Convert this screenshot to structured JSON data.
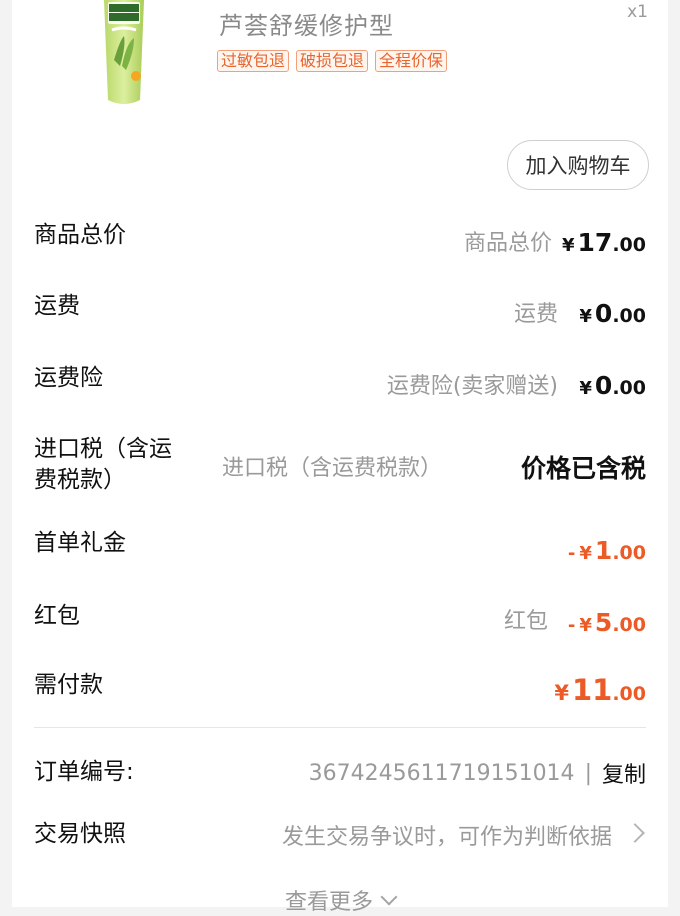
{
  "product": {
    "title": "芦荟舒缓修护型",
    "quantity": "x1",
    "tags": [
      "过敏包退",
      "破损包退",
      "全程价保"
    ],
    "image_icon": "aloe-vera-hand-cream-tube",
    "image_lettering": [
      "INSTITUTO ESPAÑOL",
      "AloeVera"
    ]
  },
  "cart_button": {
    "label": "加入购物车"
  },
  "rows": {
    "goods_total": {
      "label": "商品总价",
      "sub": "商品总价",
      "yen": "¥",
      "int": "17",
      "dec": ".00"
    },
    "shipping": {
      "label": "运费",
      "sub": "运费",
      "yen": "¥",
      "int": "0",
      "dec": ".00"
    },
    "shipping_insurance": {
      "label": "运费险",
      "sub": "运费险(卖家赠送)",
      "yen": "¥",
      "int": "0",
      "dec": ".00"
    },
    "import_tax": {
      "label_line1": "进口税（含运",
      "label_line2": "费税款）",
      "sub": "进口税（含运费税款）",
      "value": "价格已含税"
    },
    "first_order_gift": {
      "label": "首单礼金",
      "prefix": "-",
      "yen": "¥",
      "int": "1",
      "dec": ".00"
    },
    "red_packet": {
      "label": "红包",
      "sub": "红包",
      "prefix": "-",
      "yen": "¥",
      "int": "5",
      "dec": ".00"
    },
    "amount_due": {
      "label": "需付款",
      "yen": "¥",
      "int": "11",
      "dec": ".00"
    }
  },
  "order": {
    "label": "订单编号:",
    "number": "3674245611719151014",
    "separator": "|",
    "copy_label": "复制"
  },
  "snapshot": {
    "label": "交易快照",
    "text": "发生交易争议时，可作为判断依据"
  },
  "view_more": {
    "label": "查看更多"
  },
  "colors": {
    "accent": "#ec5a25",
    "tag_border": "#f3a07a",
    "muted_text": "#9a9a9a"
  }
}
